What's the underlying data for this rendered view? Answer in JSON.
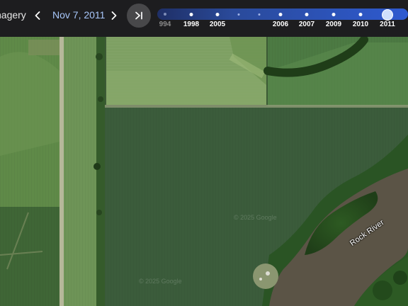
{
  "toolbar": {
    "imagery_label": "nagery",
    "current_date": "Nov 7, 2011"
  },
  "timeline": {
    "years": [
      {
        "label": "994",
        "dim": true
      },
      {
        "label": "1998"
      },
      {
        "label": "2005"
      },
      {
        "label": "2006"
      },
      {
        "label": "2007"
      },
      {
        "label": "2009"
      },
      {
        "label": "2010"
      },
      {
        "label": "2011",
        "selected": true
      }
    ]
  },
  "map": {
    "river_label": "Rock River",
    "watermarks": [
      "© 2025 Google",
      "© 2025 Google"
    ]
  },
  "icons": {
    "prev": "chevron-left-icon",
    "next": "chevron-right-icon",
    "latest": "skip-to-latest-icon"
  }
}
